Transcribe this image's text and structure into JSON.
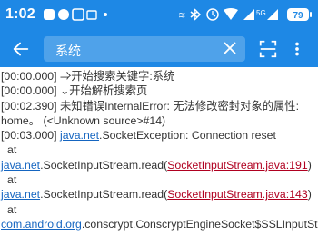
{
  "status": {
    "time": "1:02",
    "network": "4G",
    "battery": "79"
  },
  "toolbar": {
    "search_value": "系统",
    "back_icon": "arrow-left-icon",
    "clear_icon": "close-icon",
    "scan_icon": "scan-icon",
    "more_icon": "more-vert-icon"
  },
  "log": {
    "l1": "[00:00.000] ⇒开始搜索关键字:系统",
    "l2": "[00:00.000] ⌄开始解析搜索页",
    "l3": "[00:02.390] 未知错误InternalError: 无法修改密封对象的属性:",
    "l4": "home。 (<Unknown source>#14)",
    "l5_prefix": "[00:03.000] ",
    "l5_link": "java.net",
    "l5_rest": ".SocketException: Connection reset",
    "at1": "at",
    "l6_link": "java.net",
    "l6_mid": ".SocketInputStream.read(",
    "l6_red": "SocketInputStream.java:191",
    "l6_end": ")",
    "at2": "at",
    "l7_link": "java.net",
    "l7_mid": ".SocketInputStream.read(",
    "l7_red": "SocketInputStream.java:143",
    "l7_end": ")",
    "at3": "at",
    "l8_link": "com.android.org",
    "l8_rest": ".conscrypt.ConscryptEngineSocket$SSLInputStream"
  }
}
